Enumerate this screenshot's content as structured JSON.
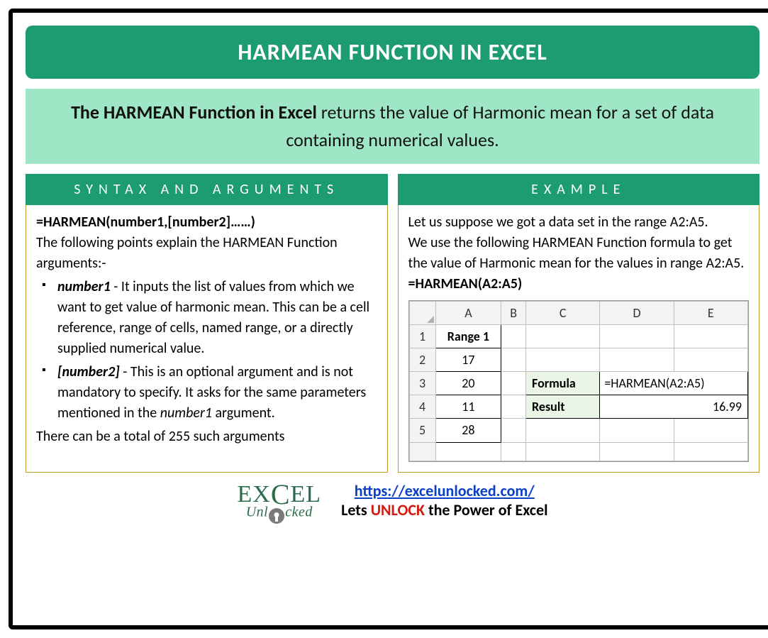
{
  "title": "HARMEAN FUNCTION IN EXCEL",
  "description_bold": "The HARMEAN Function in Excel",
  "description_rest": " returns the value of Harmonic mean for a set of data containing numerical values.",
  "syntax": {
    "header": "SYNTAX AND ARGUMENTS",
    "formula": "=HARMEAN(number1,[number2]……)",
    "intro": "The following points explain the HARMEAN Function arguments:-",
    "args": [
      {
        "name": "number1",
        "desc": " - It inputs the list of values from which we want to get value of harmonic mean. This can be a cell reference, range of cells, named range, or a directly supplied numerical value."
      },
      {
        "name": "[number2]",
        "desc": " - This is an optional argument and is not mandatory to specify. It asks for the same parameters mentioned in the ",
        "trail_italic": "number1",
        "trail_after": " argument."
      }
    ],
    "note": "There can be a total of 255 such arguments"
  },
  "example": {
    "header": "EXAMPLE",
    "line1": "Let us suppose we got a data set in the range A2:A5.",
    "line2": "We use the following HARMEAN Function formula to get the value of Harmonic mean for the values in range A2:A5.",
    "formula": "=HARMEAN(A2:A5)",
    "sheet": {
      "cols": [
        "A",
        "B",
        "C",
        "D",
        "E"
      ],
      "range_header": "Range 1",
      "values": [
        "17",
        "20",
        "11",
        "28"
      ],
      "formula_label": "Formula",
      "formula_value": "=HARMEAN(A2:A5)",
      "result_label": "Result",
      "result_value": "16.99"
    }
  },
  "footer": {
    "logo_top": "EX",
    "logo_top2": "EL",
    "logo_bottom": "Unl   cked",
    "url": "https://excelunlocked.com/",
    "tag_pre": "Lets ",
    "tag_unlock": "UNLOCK",
    "tag_post": " the Power of Excel"
  }
}
